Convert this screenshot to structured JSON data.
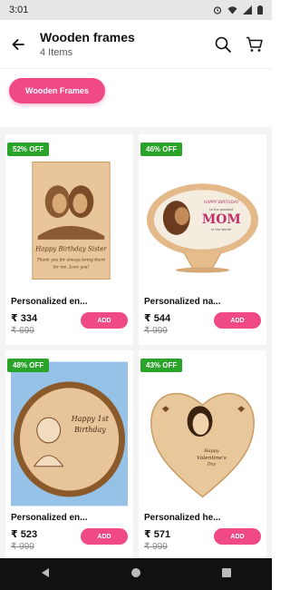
{
  "status_bar": {
    "time": "3:01"
  },
  "header": {
    "title": "Wooden frames",
    "subtitle": "4 Items"
  },
  "filter_chip": {
    "label": "Wooden Frames"
  },
  "products": [
    {
      "badge": "52% OFF",
      "name": "Personalized en...",
      "price": "₹ 334",
      "mrp": "₹ 699",
      "add_label": "ADD"
    },
    {
      "badge": "46% OFF",
      "name": "Personalized na...",
      "price": "₹ 544",
      "mrp": "₹ 999",
      "add_label": "ADD"
    },
    {
      "badge": "48% OFF",
      "name": "Personalized en...",
      "price": "₹ 523",
      "mrp": "₹ 999",
      "add_label": "ADD"
    },
    {
      "badge": "43% OFF",
      "name": "Personalized he...",
      "price": "₹ 571",
      "mrp": "₹ 999",
      "add_label": "ADD"
    }
  ],
  "product_images": [
    {
      "texts": [
        "Happy Birthday Sister",
        "Thank you for always being there",
        "for me. Love you!"
      ]
    },
    {
      "texts": [
        "to the greatest",
        "MOM",
        "in the World!",
        "HAPPY BIRTHDAY"
      ]
    },
    {
      "texts": [
        "Happy 1st",
        "Birthday"
      ]
    },
    {
      "texts": [
        "Happy",
        "Valentine's",
        "Day"
      ]
    }
  ],
  "colors": {
    "accent": "#ef4a86",
    "badge": "#2aa32a",
    "wood": "#e8c79b"
  },
  "icons": {
    "back": "arrow-left-icon",
    "search": "search-icon",
    "cart": "cart-icon"
  }
}
